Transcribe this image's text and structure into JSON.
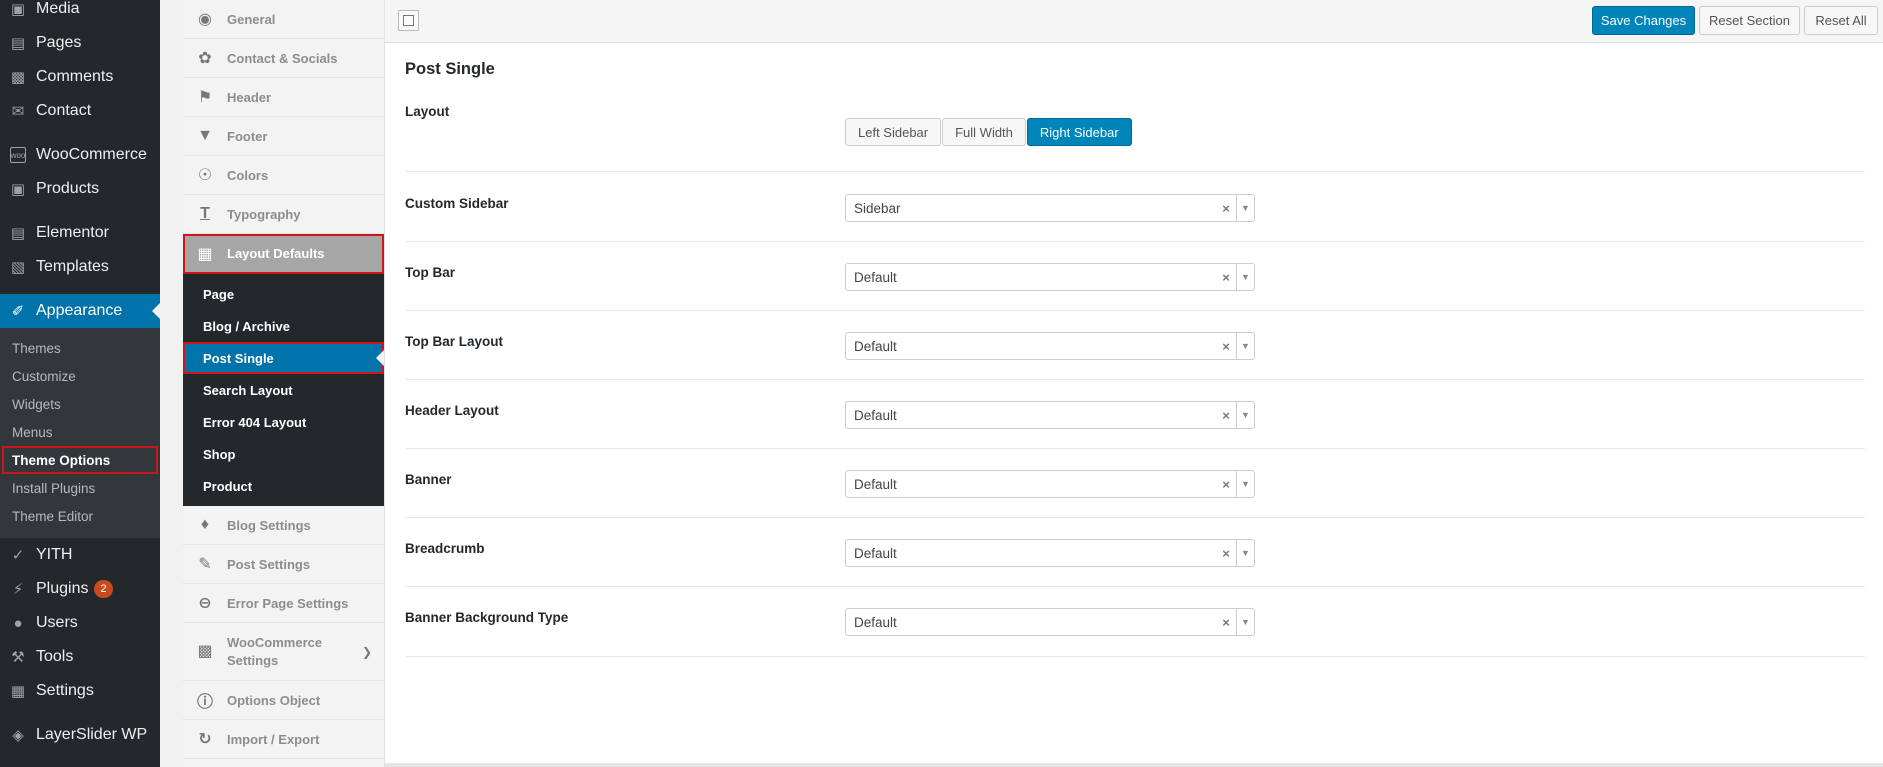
{
  "wp_menu": {
    "items_top": [
      {
        "label": "Media",
        "icon": "media-icon"
      },
      {
        "label": "Pages",
        "icon": "pages-icon"
      },
      {
        "label": "Comments",
        "icon": "comments-icon"
      },
      {
        "label": "Contact",
        "icon": "mail-icon"
      }
    ],
    "items_woo": [
      {
        "label": "WooCommerce",
        "icon": "woocommerce-icon"
      },
      {
        "label": "Products",
        "icon": "products-icon"
      }
    ],
    "items_el": [
      {
        "label": "Elementor",
        "icon": "elementor-icon"
      },
      {
        "label": "Templates",
        "icon": "templates-icon"
      }
    ],
    "appearance": {
      "label": "Appearance",
      "icon": "appearance-icon"
    },
    "appearance_sub": [
      "Themes",
      "Customize",
      "Widgets",
      "Menus",
      "Theme Options",
      "Install Plugins",
      "Theme Editor"
    ],
    "items_bottom": [
      {
        "label": "YITH",
        "icon": "yith-icon"
      },
      {
        "label": "Plugins",
        "icon": "plugins-icon",
        "badge": "2"
      },
      {
        "label": "Users",
        "icon": "users-icon"
      },
      {
        "label": "Tools",
        "icon": "tools-icon"
      },
      {
        "label": "Settings",
        "icon": "settings-icon"
      }
    ],
    "layerslider": {
      "label": "LayerSlider WP",
      "icon": "layerslider-icon"
    }
  },
  "options_menu": {
    "general": "General",
    "contact": "Contact & Socials",
    "header": "Header",
    "footer": "Footer",
    "colors": "Colors",
    "typography": "Typography",
    "layout_defaults": "Layout Defaults",
    "layout_sub": [
      "Page",
      "Blog / Archive",
      "Post Single",
      "Search Layout",
      "Error 404 Layout",
      "Shop",
      "Product"
    ],
    "blog_settings": "Blog Settings",
    "post_settings": "Post Settings",
    "error_page": "Error Page Settings",
    "woocommerce_1": "WooCommerce",
    "woocommerce_2": "Settings",
    "options_object": "Options Object",
    "import_export": "Import / Export"
  },
  "toolbar": {
    "save": "Save Changes",
    "reset_section": "Reset Section",
    "reset_all": "Reset All"
  },
  "section": {
    "title": "Post Single",
    "layout": {
      "label": "Layout",
      "options": [
        "Left Sidebar",
        "Full Width",
        "Right Sidebar"
      ],
      "selected": "Right Sidebar"
    },
    "fields": [
      {
        "label": "Custom Sidebar",
        "value": "Sidebar"
      },
      {
        "label": "Top Bar",
        "value": "Default"
      },
      {
        "label": "Top Bar Layout",
        "value": "Default"
      },
      {
        "label": "Header Layout",
        "value": "Default"
      },
      {
        "label": "Banner",
        "value": "Default"
      },
      {
        "label": "Breadcrumb",
        "value": "Default"
      },
      {
        "label": "Banner Background Type",
        "value": "Default"
      }
    ]
  }
}
